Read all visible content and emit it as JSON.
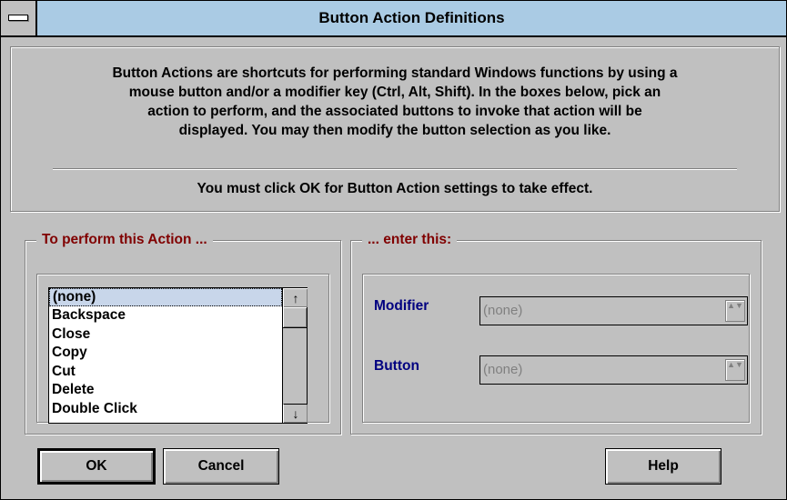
{
  "window": {
    "title": "Button Action Definitions"
  },
  "info": {
    "lines": [
      "Button Actions are shortcuts for performing standard Windows functions by using a",
      "mouse button and/or a modifier key (Ctrl, Alt, Shift).  In the boxes below, pick an",
      "action to perform, and the associated buttons to invoke that action will be",
      "displayed.  You may then modify the button selection as you like."
    ],
    "note": "You must click OK for Button Action settings to take effect."
  },
  "action_group": {
    "legend": "To perform this Action ...",
    "items": [
      "(none)",
      "Backspace",
      "Close",
      "Copy",
      "Cut",
      "Delete",
      "Double Click"
    ],
    "selected_index": 0,
    "scroll_up_glyph": "↑",
    "scroll_down_glyph": "↓"
  },
  "enter_group": {
    "legend": "... enter this:",
    "modifier_label": "Modifier",
    "modifier_value": "(none)",
    "button_label": "Button",
    "button_value": "(none)",
    "spin_glyph": "▲▼"
  },
  "buttons": {
    "ok": "OK",
    "cancel": "Cancel",
    "help": "Help"
  },
  "icons": [
    "system-menu-icon",
    "scroll-up-icon",
    "scroll-down-icon",
    "spin-icon"
  ],
  "colors": {
    "titlebar": "#aacbe4",
    "face": "#c0c0c0",
    "legend_text": "#800000",
    "field_label": "#000080",
    "selection": "#c8d6ea"
  }
}
